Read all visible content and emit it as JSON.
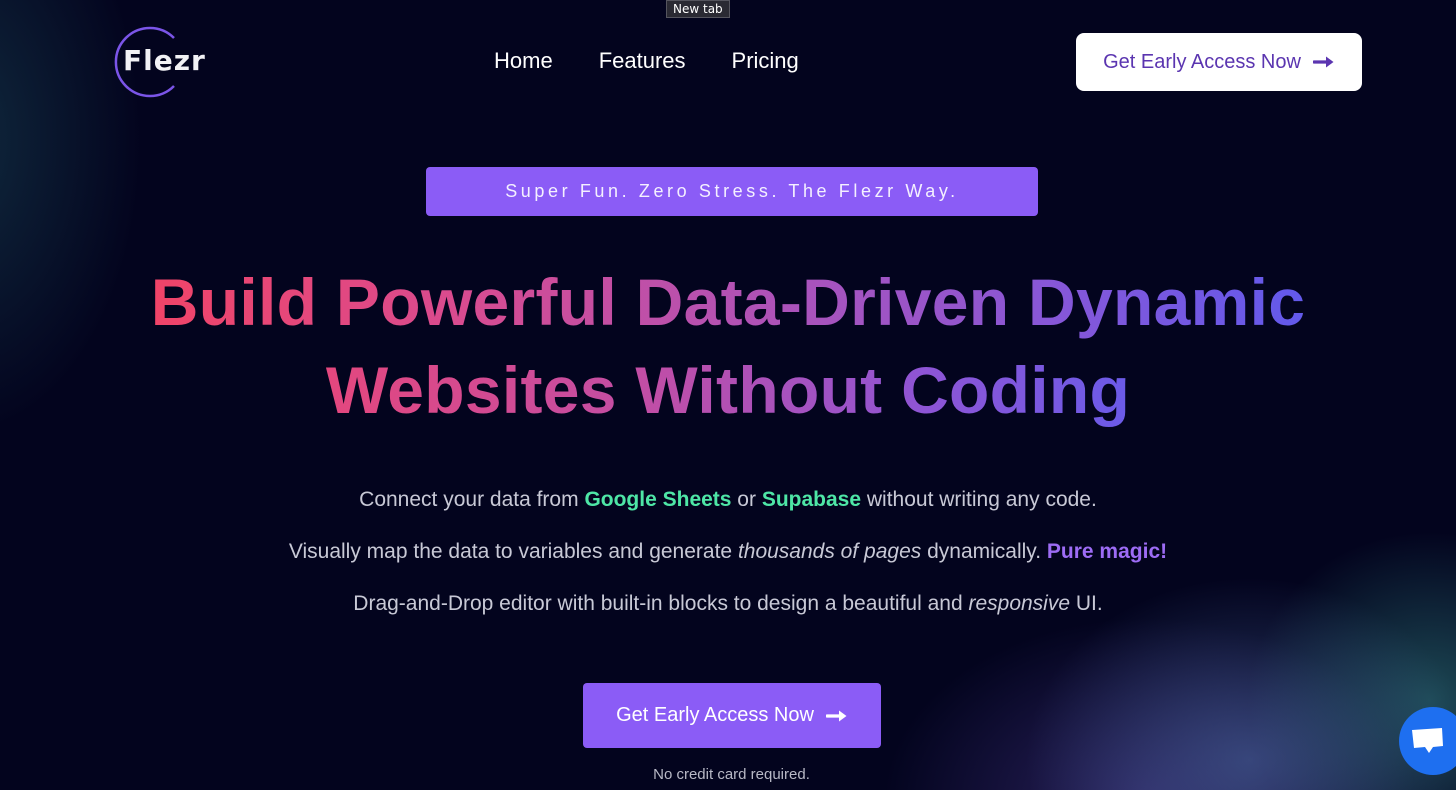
{
  "tooltip": {
    "text": "New tab"
  },
  "header": {
    "logo_text": "Flezr",
    "nav": [
      {
        "label": "Home"
      },
      {
        "label": "Features"
      },
      {
        "label": "Pricing"
      }
    ],
    "cta_label": "Get Early Access Now",
    "cta_icon": "arrow-right-icon"
  },
  "hero": {
    "tagline": "Super Fun. Zero Stress. The Flezr Way.",
    "headline_line1": "Build Powerful Data-Driven Dynamic",
    "headline_line2": "Websites Without Coding",
    "desc1": {
      "pre": "Connect your data from ",
      "hl1": "Google Sheets",
      "mid": " or ",
      "hl2": "Supabase",
      "post": " without writing any code."
    },
    "desc2": {
      "pre": "Visually map the data to variables and generate ",
      "italic": "thousands of pages",
      "mid": " dynamically. ",
      "hl": "Pure magic!"
    },
    "desc3": {
      "pre": "Drag-and-Drop editor with built-in blocks to design a beautiful and ",
      "italic": "responsive",
      "post": " UI."
    },
    "cta_label": "Get Early Access Now",
    "cta_icon": "arrow-right-icon",
    "note": "No credit card required."
  },
  "chat_widget": {
    "icon": "chat-bubble-icon"
  },
  "colors": {
    "background": "#03041e",
    "accent_purple": "#8b5cf6",
    "highlight_green": "#4ee6a6",
    "header_cta_text": "#5b35b0",
    "chat_blue": "#1e6ff0"
  }
}
